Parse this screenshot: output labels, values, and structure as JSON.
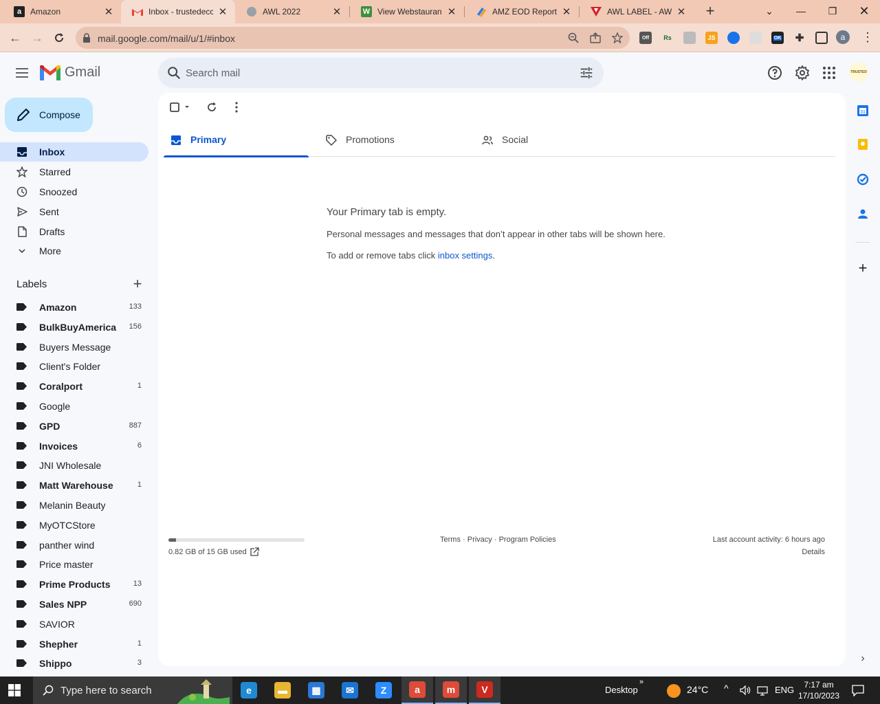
{
  "browser": {
    "tabs": [
      {
        "title": "Amazon",
        "favicon": "amazon-a",
        "active": false
      },
      {
        "title": "Inbox - trustedecc",
        "favicon": "gmail-m",
        "active": true
      },
      {
        "title": "AWL 2022",
        "favicon": "globe",
        "active": false
      },
      {
        "title": "View Webstaurant",
        "favicon": "webstaurant-w",
        "active": false
      },
      {
        "title": "AMZ EOD Report",
        "favicon": "zoho-swirl",
        "active": false
      },
      {
        "title": "AWL LABEL - AWL",
        "favicon": "awl-v",
        "active": false
      }
    ],
    "url": "mail.google.com/mail/u/1/#inbox",
    "extensions": [
      "Off",
      "Rs",
      "JS",
      "OK"
    ],
    "profile_initial": "a"
  },
  "gmail": {
    "logo_text": "Gmail",
    "search_placeholder": "Search mail",
    "account_badge": "TRUSTED",
    "compose_label": "Compose",
    "nav": [
      {
        "label": "Inbox",
        "icon": "inbox-icon",
        "selected": true
      },
      {
        "label": "Starred",
        "icon": "star-icon",
        "selected": false
      },
      {
        "label": "Snoozed",
        "icon": "clock-icon",
        "selected": false
      },
      {
        "label": "Sent",
        "icon": "send-icon",
        "selected": false
      },
      {
        "label": "Drafts",
        "icon": "draft-icon",
        "selected": false
      },
      {
        "label": "More",
        "icon": "chevron-down-icon",
        "selected": false
      }
    ],
    "labels_heading": "Labels",
    "labels": [
      {
        "name": "Amazon",
        "count": "133",
        "bold": true
      },
      {
        "name": "BulkBuyAmerica",
        "count": "156",
        "bold": true
      },
      {
        "name": "Buyers Message",
        "count": "",
        "bold": false
      },
      {
        "name": "Client's Folder",
        "count": "",
        "bold": false
      },
      {
        "name": "Coralport",
        "count": "1",
        "bold": true
      },
      {
        "name": "Google",
        "count": "",
        "bold": false
      },
      {
        "name": "GPD",
        "count": "887",
        "bold": true
      },
      {
        "name": "Invoices",
        "count": "6",
        "bold": true
      },
      {
        "name": "JNI Wholesale",
        "count": "",
        "bold": false
      },
      {
        "name": "Matt Warehouse",
        "count": "1",
        "bold": true
      },
      {
        "name": "Melanin Beauty",
        "count": "",
        "bold": false
      },
      {
        "name": "MyOTCStore",
        "count": "",
        "bold": false
      },
      {
        "name": "panther wind",
        "count": "",
        "bold": false
      },
      {
        "name": "Price master",
        "count": "",
        "bold": false
      },
      {
        "name": "Prime Products",
        "count": "13",
        "bold": true
      },
      {
        "name": "Sales NPP",
        "count": "690",
        "bold": true
      },
      {
        "name": "SAVIOR",
        "count": "",
        "bold": false
      },
      {
        "name": "Shepher",
        "count": "1",
        "bold": true
      },
      {
        "name": "Shippo",
        "count": "3",
        "bold": true
      }
    ],
    "inbox_tabs": [
      {
        "label": "Primary",
        "icon": "inbox-tab-icon",
        "active": true
      },
      {
        "label": "Promotions",
        "icon": "tag-icon",
        "active": false
      },
      {
        "label": "Social",
        "icon": "people-icon",
        "active": false
      }
    ],
    "empty_state": {
      "title": "Your Primary tab is empty.",
      "description": "Personal messages and messages that don’t appear in other tabs will be shown here.",
      "tip_prefix": "To add or remove tabs click ",
      "tip_link": "inbox settings",
      "tip_suffix": "."
    },
    "footer": {
      "storage_text": "0.82 GB of 15 GB used",
      "storage_fraction": 0.055,
      "terms": "Terms",
      "privacy": "Privacy",
      "program_policies": "Program Policies",
      "separator": " · ",
      "last_activity": "Last account activity: 6 hours ago",
      "details": "Details"
    }
  },
  "taskbar": {
    "search_placeholder": "Type here to search",
    "apps": [
      {
        "name": "edge",
        "glyph": "e",
        "color": "#1f8ad2",
        "running": false
      },
      {
        "name": "file-explorer",
        "glyph": "▬",
        "color": "#e8b730",
        "running": false
      },
      {
        "name": "microsoft-store",
        "glyph": "▦",
        "color": "#2b78d4",
        "running": false
      },
      {
        "name": "mail",
        "glyph": "✉",
        "color": "#1b74d1",
        "running": false
      },
      {
        "name": "zoom",
        "glyph": "Z",
        "color": "#2d8cff",
        "running": false
      },
      {
        "name": "chrome-profile-a",
        "glyph": "a",
        "color": "#dd4b39",
        "running": true
      },
      {
        "name": "chrome-profile-m",
        "glyph": "m",
        "color": "#dd4b39",
        "running": true
      },
      {
        "name": "vivaldi-app",
        "glyph": "V",
        "color": "#cc2a1e",
        "running": true
      }
    ],
    "desktop_label": "Desktop",
    "weather": "24°C",
    "language": "ENG",
    "time": "7:17 am",
    "date": "17/10/2023"
  }
}
